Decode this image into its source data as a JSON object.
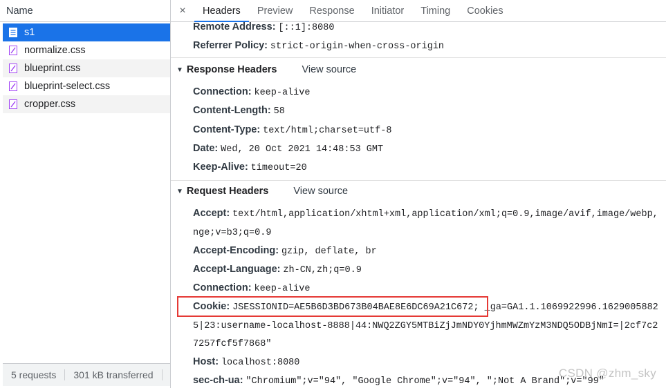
{
  "left_pane": {
    "header": "Name",
    "files": [
      {
        "name": "s1",
        "icon": "document-icon",
        "selected": true
      },
      {
        "name": "normalize.css",
        "icon": "stylesheet-icon"
      },
      {
        "name": "blueprint.css",
        "icon": "stylesheet-icon"
      },
      {
        "name": "blueprint-select.css",
        "icon": "stylesheet-icon"
      },
      {
        "name": "cropper.css",
        "icon": "stylesheet-icon"
      }
    ],
    "status": {
      "requests": "5 requests",
      "transferred": "301 kB transferred"
    }
  },
  "tabs": {
    "close": "×",
    "items": [
      "Headers",
      "Preview",
      "Response",
      "Initiator",
      "Timing",
      "Cookies"
    ],
    "active": "Headers"
  },
  "general": {
    "remote_address": {
      "key": "Remote Address:",
      "value": "[::1]:8080"
    },
    "referrer_policy": {
      "key": "Referrer Policy:",
      "value": "strict-origin-when-cross-origin"
    }
  },
  "response_headers": {
    "title": "Response Headers",
    "view_source": "View source",
    "items": [
      {
        "key": "Connection:",
        "value": "keep-alive"
      },
      {
        "key": "Content-Length:",
        "value": "58"
      },
      {
        "key": "Content-Type:",
        "value": "text/html;charset=utf-8"
      },
      {
        "key": "Date:",
        "value": "Wed, 20 Oct 2021 14:48:53 GMT"
      },
      {
        "key": "Keep-Alive:",
        "value": "timeout=20"
      }
    ]
  },
  "request_headers": {
    "title": "Request Headers",
    "view_source": "View source",
    "accept": {
      "key": "Accept:",
      "value": "text/html,application/xhtml+xml,application/xml;q=0.9,image/avif,image/webp,",
      "cont": "nge;v=b3;q=0.9"
    },
    "accept_encoding": {
      "key": "Accept-Encoding:",
      "value": "gzip, deflate, br"
    },
    "accept_language": {
      "key": "Accept-Language:",
      "value": "zh-CN,zh;q=0.9"
    },
    "connection": {
      "key": "Connection:",
      "value": "keep-alive"
    },
    "cookie": {
      "key": "Cookie:",
      "value": "JSESSIONID=AE5B6D3BD673B04BAE8E6DC69A21C672;",
      "rest": " _ga=GA1.1.1069922996.1629005882",
      "cont1": "5|23:username-localhost-8888|44:NWQ2ZGY5MTBiZjJmNDY0YjhmMWZmYzM3NDQ5ODBjNmI=|2cf7c2",
      "cont2": "7257fcf5f7868\""
    },
    "host": {
      "key": "Host:",
      "value": "localhost:8080"
    },
    "sec_ch_ua": {
      "key": "sec-ch-ua:",
      "value": "\"Chromium\";v=\"94\", \"Google Chrome\";v=\"94\", \";Not A Brand\";v=\"99\""
    }
  },
  "watermark": "CSDN @zhm_sky",
  "colors": {
    "selected": "#1a73e8",
    "highlight_box": "#e53935"
  }
}
